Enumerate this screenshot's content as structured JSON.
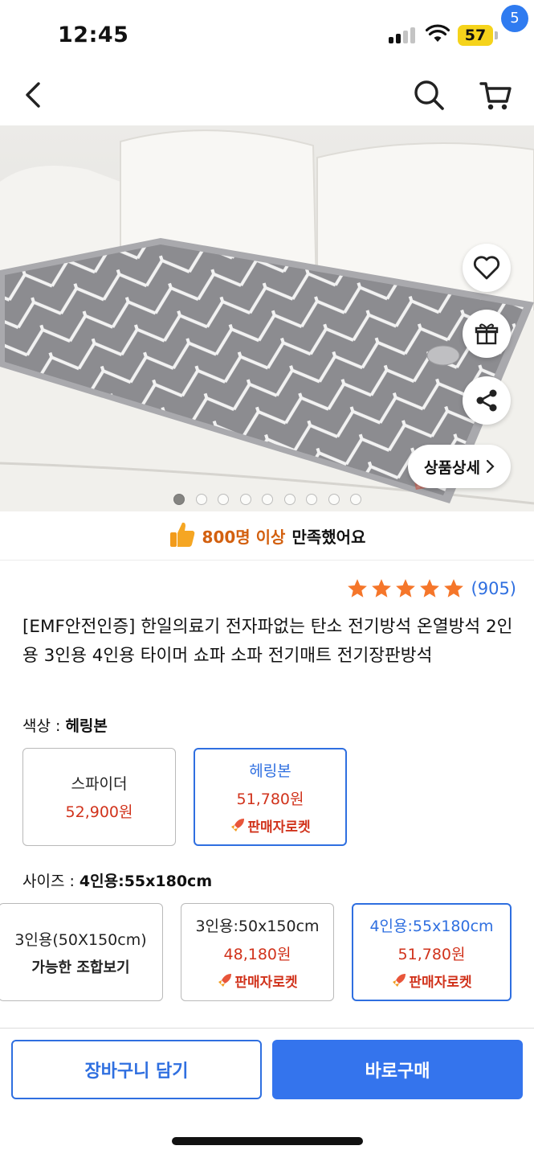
{
  "status_bar": {
    "time": "12:45",
    "battery": "57"
  },
  "nav": {
    "cart_count": "5"
  },
  "hero": {
    "detail_button": "상품상세",
    "slide_count": 9,
    "active_slide": 1
  },
  "satisfaction": {
    "highlight": "800명 이상",
    "rest": "만족했어요"
  },
  "rating": {
    "stars": 5,
    "count": "(905)"
  },
  "product": {
    "title": "[EMF안전인증] 한일의료기 전자파없는 탄소 전기방석 온열방석 2인용 3인용 4인용 타이머 쇼파 소파 전기매트 전기장판방석"
  },
  "color_option": {
    "label": "색상 : ",
    "selected": "헤링본",
    "items": [
      {
        "name": "스파이더",
        "price": "52,900원",
        "badge": ""
      },
      {
        "name": "헤링본",
        "price": "51,780원",
        "badge": "판매자로켓"
      }
    ]
  },
  "size_option": {
    "label": "사이즈 : ",
    "selected": "4인용:55x180cm",
    "items": [
      {
        "name": "3인용(50X150cm)",
        "sub": "가능한 조합보기"
      },
      {
        "name": "3인용:50x150cm",
        "price": "48,180원",
        "badge": "판매자로켓"
      },
      {
        "name": "4인용:55x180cm",
        "price": "51,780원",
        "badge": "판매자로켓"
      }
    ]
  },
  "actions": {
    "add_to_cart": "장바구니 담기",
    "buy_now": "바로구매"
  },
  "colors": {
    "accent": "#2f6fe0",
    "price": "#d1331c",
    "highlight": "#d3600f",
    "star": "#f5762a",
    "buy": "#3474ed"
  }
}
